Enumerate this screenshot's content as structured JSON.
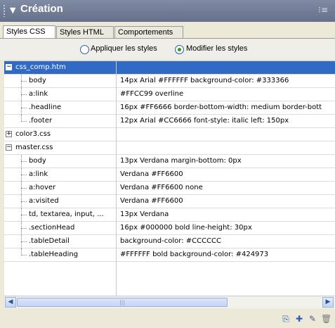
{
  "panel": {
    "title": "Création",
    "title_arrow": "▼",
    "options_icon": "⁝≡"
  },
  "tabs": [
    {
      "label": "Styles CSS",
      "active": true
    },
    {
      "label": "Styles HTML",
      "active": false
    },
    {
      "label": "Comportements",
      "active": false
    }
  ],
  "radio": {
    "apply_label": "Appliquer les styles",
    "modify_label": "Modifier les styles",
    "selected": "modify"
  },
  "tree": {
    "groups": [
      {
        "name": "css_comp.htm",
        "expanded": true,
        "selected": true,
        "items": [
          {
            "name": "body",
            "value": "14px Arial #FFFFFF background-color: #333366"
          },
          {
            "name": "a:link",
            "value": "#FFCC99 overline"
          },
          {
            "name": ".headline",
            "value": "16px #FF6666 border-bottom-width: medium border-bott"
          },
          {
            "name": ".footer",
            "value": "12px Arial #CC6666 font-style: italic left: 150px"
          }
        ]
      },
      {
        "name": "color3.css",
        "expanded": false,
        "items": []
      },
      {
        "name": "master.css",
        "expanded": true,
        "items": [
          {
            "name": "body",
            "value": "13px Verdana margin-bottom: 0px"
          },
          {
            "name": "a:link",
            "value": "Verdana #FF6600"
          },
          {
            "name": "a:hover",
            "value": "Verdana #FF6600 none"
          },
          {
            "name": "a:visited",
            "value": "Verdana #FF6600"
          },
          {
            "name": "td, textarea, input, ...",
            "value": "13px Verdana"
          },
          {
            "name": ".sectionHead",
            "value": "16px #000000 bold line-height: 30px"
          },
          {
            "name": ".tableDetail",
            "value": "background-color: #CCCCCC"
          },
          {
            "name": ".tableHeading",
            "value": "#FFFFFF bold background-color: #424973"
          }
        ]
      }
    ]
  },
  "scrollbar": {
    "left_arrow": "◀",
    "right_arrow": "▶",
    "grip": "|||"
  },
  "footer_icons": [
    {
      "name": "attach-style-sheet-icon",
      "glyph": "⎘"
    },
    {
      "name": "new-style-icon",
      "glyph": "✚"
    },
    {
      "name": "edit-style-icon",
      "glyph": "✎"
    },
    {
      "name": "delete-style-icon",
      "glyph": "🗑"
    }
  ],
  "colors": {
    "selection": "#316ac5",
    "titlebar": "#6e7892",
    "accent_radio": "#2a9a2a"
  }
}
